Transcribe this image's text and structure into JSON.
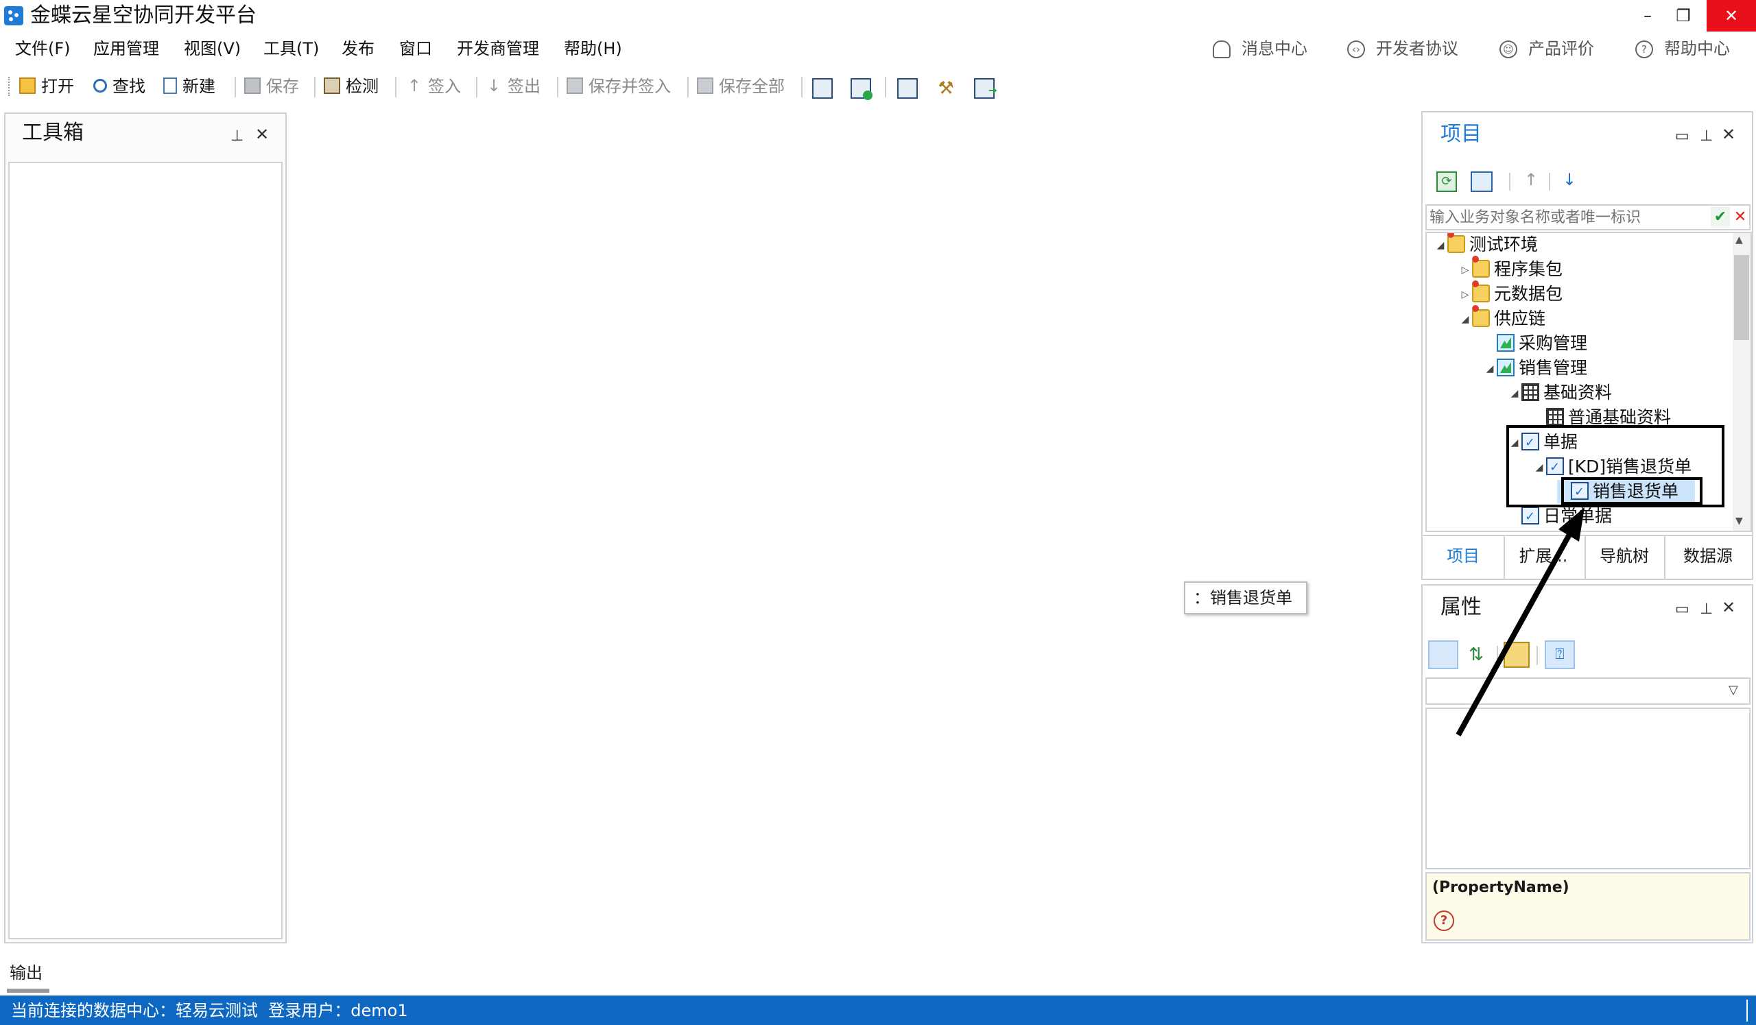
{
  "window": {
    "title": "金蝶云星空协同开发平台",
    "buttons": [
      "–",
      "❐",
      "✕"
    ]
  },
  "menu": {
    "items": [
      "文件(F)",
      "应用管理",
      "视图(V)",
      "工具(T)",
      "发布",
      "窗口",
      "开发商管理",
      "帮助(H)"
    ],
    "right": [
      "消息中心",
      "开发者协议",
      "产品评价",
      "帮助中心"
    ]
  },
  "toolbar": {
    "open": "打开",
    "find": "查找",
    "new": "新建",
    "save": "保存",
    "check": "检测",
    "checkin": "签入",
    "checkout": "签出",
    "save_checkin": "保存并签入",
    "save_all": "保存全部"
  },
  "toolbox": {
    "title": "工具箱"
  },
  "project": {
    "title": "项目",
    "search_placeholder": "输入业务对象名称或者唯一标识",
    "tree": [
      "测试环境",
      "程序集包",
      "元数据包",
      "供应链",
      "采购管理",
      "销售管理",
      "基础资料",
      "普通基础资料",
      "单据",
      "[KD]销售退货单",
      "销售退货单",
      "日常单据"
    ],
    "tabs": [
      "项目",
      "扩展...",
      "导航树",
      "数据源"
    ]
  },
  "tooltip": {
    "text": "：销售退货单"
  },
  "properties": {
    "title": "属性",
    "desc_name": "(PropertyName)"
  },
  "output": {
    "label": "输出"
  },
  "status": {
    "text": "当前连接的数据中心：轻易云测试  登录用户：demo1"
  },
  "colors": {
    "accent": "#1e7bd6",
    "statusbar": "#0e68c2",
    "close": "#e8101a",
    "selection": "#cce4fb"
  }
}
